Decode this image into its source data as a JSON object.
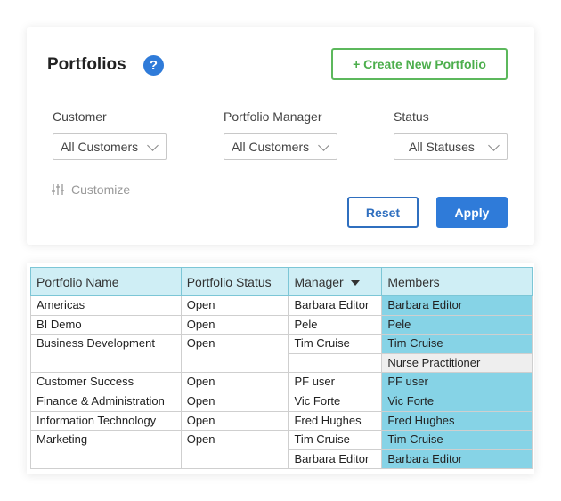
{
  "header": {
    "title": "Portfolios",
    "help_icon": "?",
    "create_label": "+ Create New Portfolio"
  },
  "filters": {
    "customer": {
      "label": "Customer",
      "value": "All Customers"
    },
    "manager": {
      "label": "Portfolio Manager",
      "value": "All Customers"
    },
    "status": {
      "label": "Status",
      "value": "All Statuses"
    },
    "customize_label": "Customize",
    "reset_label": "Reset",
    "apply_label": "Apply"
  },
  "colors": {
    "accent": "#2f7bd9",
    "create_green": "#5cb85c",
    "header_bg": "#cfeef5",
    "highlight": "#86d3e6"
  },
  "table": {
    "columns": [
      "Portfolio Name",
      "Portfolio Status",
      "Manager",
      "Members"
    ],
    "rows": [
      {
        "name": "Americas",
        "status": "Open",
        "members": [
          {
            "manager": "Barbara Editor",
            "member": "Barbara Editor"
          }
        ]
      },
      {
        "name": "BI Demo",
        "status": "Open",
        "members": [
          {
            "manager": "Pele",
            "member": "Pele"
          }
        ]
      },
      {
        "name": "Business Development",
        "status": "Open",
        "members": [
          {
            "manager": "Tim Cruise",
            "member": "Tim Cruise"
          },
          {
            "manager": "",
            "member": "Nurse Practitioner"
          }
        ]
      },
      {
        "name": "Customer Success",
        "status": "Open",
        "members": [
          {
            "manager": "PF user",
            "member": "PF user"
          }
        ]
      },
      {
        "name": "Finance & Administration",
        "status": "Open",
        "members": [
          {
            "manager": "Vic Forte",
            "member": "Vic Forte"
          }
        ]
      },
      {
        "name": "Information Technology",
        "status": "Open",
        "members": [
          {
            "manager": "Fred Hughes",
            "member": "Fred Hughes"
          }
        ]
      },
      {
        "name": "Marketing",
        "status": "Open",
        "members": [
          {
            "manager": "Tim Cruise",
            "member": "Tim Cruise"
          },
          {
            "manager": "Barbara Editor",
            "member": "Barbara Editor"
          }
        ]
      }
    ]
  }
}
